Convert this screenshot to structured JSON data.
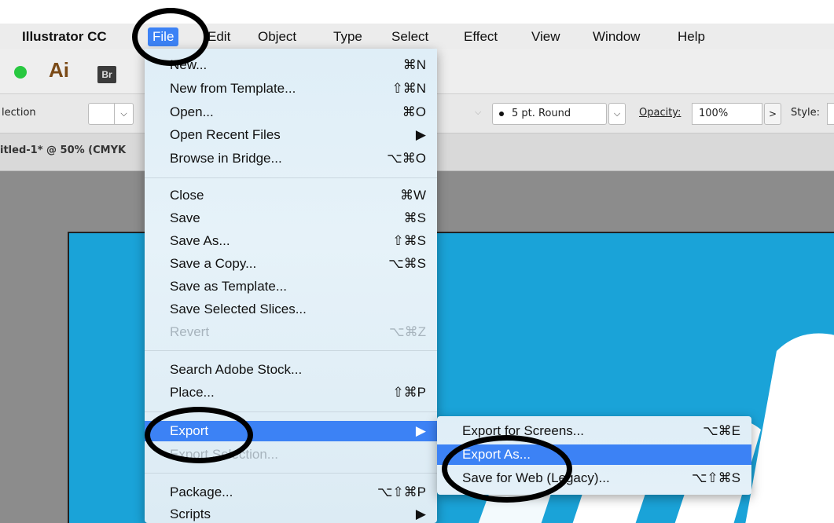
{
  "menubar": {
    "app_name": "Illustrator CC",
    "items": [
      "File",
      "Edit",
      "Object",
      "Type",
      "Select",
      "Effect",
      "View",
      "Window",
      "Help"
    ]
  },
  "appbar": {
    "ai_logo": "Ai",
    "bridge_logo": "Br"
  },
  "controlbar": {
    "selection_label": "lection",
    "swatch_dropdown": "⌵",
    "brush_value": "5 pt. Round",
    "brush_dropdown": "⌵",
    "opacity_label": "Opacity:",
    "opacity_value": "100%",
    "opacity_arrow": ">",
    "style_label": "Style:"
  },
  "document": {
    "tab_title": "itled-1* @ 50% (CMYK"
  },
  "file_menu": {
    "items": [
      {
        "label": "New...",
        "shortcut": "⌘N"
      },
      {
        "label": "New from Template...",
        "shortcut": "⇧⌘N"
      },
      {
        "label": "Open...",
        "shortcut": "⌘O"
      },
      {
        "label": "Open Recent Files",
        "shortcut": "▶"
      },
      {
        "label": "Browse in Bridge...",
        "shortcut": "⌥⌘O"
      },
      {
        "label": "Close",
        "shortcut": "⌘W"
      },
      {
        "label": "Save",
        "shortcut": "⌘S"
      },
      {
        "label": "Save As...",
        "shortcut": "⇧⌘S"
      },
      {
        "label": "Save a Copy...",
        "shortcut": "⌥⌘S"
      },
      {
        "label": "Save as Template...",
        "shortcut": ""
      },
      {
        "label": "Save Selected Slices...",
        "shortcut": ""
      },
      {
        "label": "Revert",
        "shortcut": "⌥⌘Z"
      },
      {
        "label": "Search Adobe Stock...",
        "shortcut": ""
      },
      {
        "label": "Place...",
        "shortcut": "⇧⌘P"
      },
      {
        "label": "Export",
        "shortcut": "▶"
      },
      {
        "label": "Export Selection...",
        "shortcut": ""
      },
      {
        "label": "Package...",
        "shortcut": "⌥⇧⌘P"
      },
      {
        "label": "Scripts",
        "shortcut": "▶"
      }
    ]
  },
  "export_submenu": {
    "items": [
      {
        "label": "Export for Screens...",
        "shortcut": "⌥⌘E"
      },
      {
        "label": "Export As...",
        "shortcut": ""
      },
      {
        "label": "Save for Web (Legacy)...",
        "shortcut": "⌥⇧⌘S"
      }
    ]
  },
  "colors": {
    "menu_highlight": "#3c82f5",
    "artboard": "#1aa3d8",
    "canvas": "#8c8c8c",
    "annotation_ring": "#000000"
  }
}
